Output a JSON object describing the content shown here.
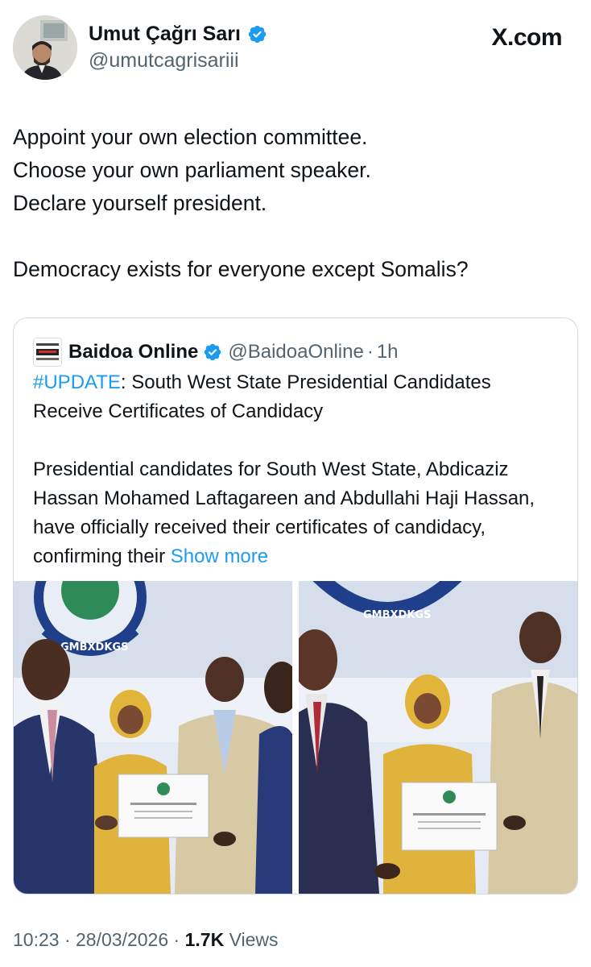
{
  "author": {
    "display_name": "Umut Çağrı Sarı",
    "handle": "@umutcagrisariii"
  },
  "source_label": "X.com",
  "tweet_lines": [
    "Appoint your own election committee.",
    "Choose your own parliament speaker.",
    "Declare yourself president.",
    "",
    "Democracy exists for everyone except Somalis?"
  ],
  "quote": {
    "name": "Baidoa Online",
    "handle": "@BaidoaOnline",
    "time_sep": "·",
    "time": "1h",
    "hashtag": "#UPDATE",
    "headline": ": South West State Presidential Candidates Receive Certificates of Candidacy",
    "body": "Presidential candidates for South West State, Abdicaziz Hassan Mohamed Laftagareen and Abdullahi Haji Hassan, have officially received their certificates of candidacy, confirming their",
    "show_more": "Show more",
    "photo_banner": "GMBXDKGS"
  },
  "footer": {
    "time": "10:23",
    "sep1": " · ",
    "date": "28/03/2026",
    "sep2": " · ",
    "views_count": "1.7K",
    "views_label": " Views"
  },
  "colors": {
    "accent": "#1d9bf0",
    "muted": "#536471",
    "text": "#0f1419",
    "border": "#cfd9de"
  }
}
